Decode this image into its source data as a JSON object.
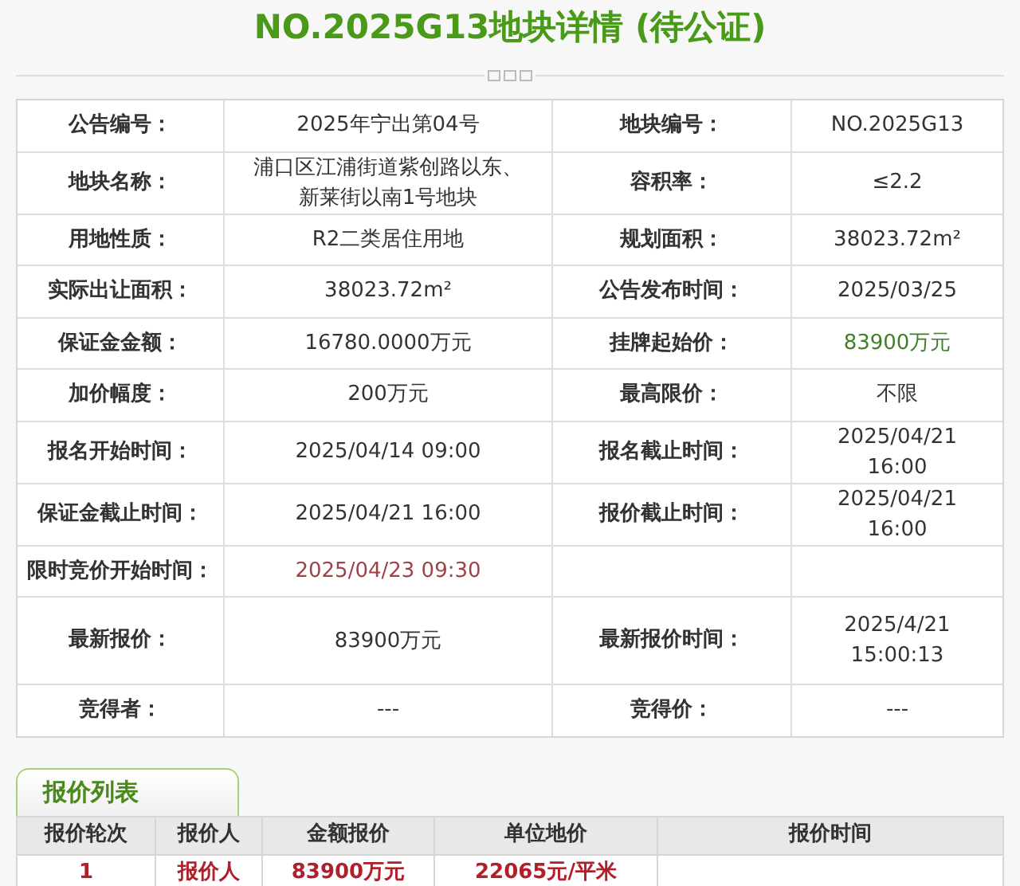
{
  "title": "NO.2025G13地块详情 (待公证)",
  "details": [
    [
      {
        "label": "公告编号：",
        "value": "2025年宁出第04号",
        "kind": "plain"
      },
      {
        "label": "地块编号：",
        "value": "NO.2025G13",
        "kind": "plain"
      }
    ],
    [
      {
        "label": "地块名称：",
        "value": "浦口区江浦街道紫创路以东、新莱街以南1号地块",
        "kind": "plain"
      },
      {
        "label": "容积率：",
        "value": "≤2.2",
        "kind": "plain"
      }
    ],
    [
      {
        "label": "用地性质：",
        "value": "R2二类居住用地",
        "kind": "plain"
      },
      {
        "label": "规划面积：",
        "value": "38023.72m²",
        "kind": "plain"
      }
    ],
    [
      {
        "label": "实际出让面积：",
        "value": "38023.72m²",
        "kind": "plain"
      },
      {
        "label": "公告发布时间：",
        "value": "2025/03/25",
        "kind": "plain"
      }
    ],
    [
      {
        "label": "保证金金额：",
        "value": "16780.0000万元",
        "kind": "plain"
      },
      {
        "label": "挂牌起始价：",
        "value": "83900万元",
        "kind": "green"
      }
    ],
    [
      {
        "label": "加价幅度：",
        "value": "200万元",
        "kind": "plain"
      },
      {
        "label": "最高限价：",
        "value": "不限",
        "kind": "plain"
      }
    ],
    [
      {
        "label": "报名开始时间：",
        "value": "2025/04/14 09:00",
        "kind": "plain"
      },
      {
        "label": "报名截止时间：",
        "value": "2025/04/21 16:00",
        "kind": "plain"
      }
    ],
    [
      {
        "label": "保证金截止时间：",
        "value": "2025/04/21 16:00",
        "kind": "plain"
      },
      {
        "label": "报价截止时间：",
        "value": "2025/04/21 16:00",
        "kind": "plain"
      }
    ],
    [
      {
        "label": "限时竞价开始时间：",
        "value": "2025/04/23 09:30",
        "kind": "red"
      }
    ],
    [
      {
        "label": "最新报价：",
        "value": "83900万元",
        "kind": "plain"
      },
      {
        "label": "最新报价时间：",
        "value": "2025/4/21 15:00:13",
        "kind": "plain"
      }
    ],
    [
      {
        "label": "竞得者：",
        "value": "---",
        "kind": "plain"
      },
      {
        "label": "竞得价：",
        "value": "---",
        "kind": "plain"
      }
    ]
  ],
  "bid_tab": {
    "label": "报价列表"
  },
  "bid_table": {
    "columns": [
      "报价轮次",
      "报价人",
      "金额报价",
      "单位地价",
      "报价时间"
    ],
    "rows": [
      [
        "1",
        "报价人",
        "83900万元",
        "22065元/平米"
      ]
    ]
  }
}
